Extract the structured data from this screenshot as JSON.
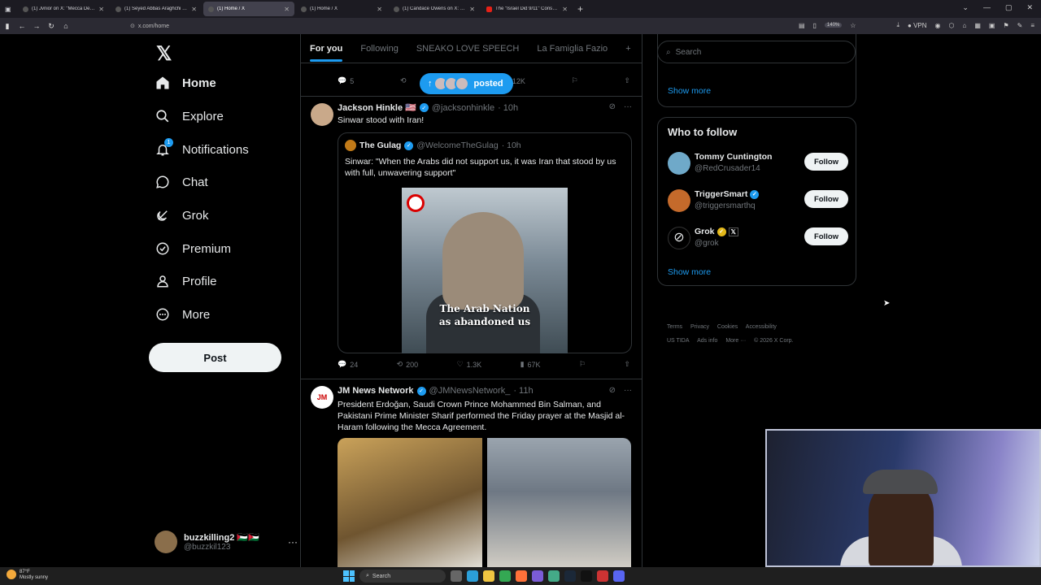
{
  "browser": {
    "tabs": [
      {
        "title": "(1) Jvnior on X: \"Mecca Defens...",
        "active": false
      },
      {
        "title": "(1) Seyed Abbas Araghchi on X...",
        "active": false
      },
      {
        "title": "(1) Home / X",
        "active": true
      },
      {
        "title": "(1) Home / X",
        "active": false
      },
      {
        "title": "(1) Candace Owens on X: \"You...",
        "active": false
      },
      {
        "title": "The \"Israel Did 9/11\" Conspira...",
        "active": false
      }
    ],
    "new_tab": "+",
    "url": "x.com/home",
    "zoom": "140%",
    "vpn": "VPN"
  },
  "nav": {
    "logo": "𝕏",
    "items": [
      {
        "label": "Home",
        "icon": "home-icon"
      },
      {
        "label": "Explore",
        "icon": "search-icon"
      },
      {
        "label": "Notifications",
        "icon": "bell-icon",
        "badge": "1"
      },
      {
        "label": "Chat",
        "icon": "chat-icon"
      },
      {
        "label": "Grok",
        "icon": "grok-icon"
      },
      {
        "label": "Premium",
        "icon": "premium-icon"
      },
      {
        "label": "Profile",
        "icon": "person-icon"
      },
      {
        "label": "More",
        "icon": "more-circle-icon"
      }
    ],
    "post_label": "Post",
    "account": {
      "name": "buzzkilling2 🇵🇸🇯🇴",
      "handle": "@buzzkil123"
    }
  },
  "feed": {
    "tabs": [
      "For you",
      "Following",
      "SNEAKO LOVE SPEECH",
      "La Famiglia Fazio"
    ],
    "add_tab": "+",
    "posted_pill": "posted",
    "prev_actions": {
      "replies": "5",
      "reposts": "",
      "likes": "",
      "views": "12K"
    },
    "tweets": [
      {
        "name": "Jackson Hinkle 🇺🇸",
        "handle": "@jacksonhinkle",
        "time": "· 10h",
        "text": "Sinwar stood with Iran!",
        "quote": {
          "name": "The Gulag",
          "handle": "@WelcomeTheGulag",
          "time": "· 10h",
          "text": "Sinwar: \"When the Arabs did not support us, it was Iran that stood by us with full, unwavering support\"",
          "caption_line1": "The Arab Nation",
          "caption_line2": "as abandoned us"
        },
        "actions": {
          "replies": "24",
          "reposts": "200",
          "likes": "1.3K",
          "views": "67K"
        }
      },
      {
        "name": "JM News Network",
        "handle": "@JMNewsNetwork_",
        "time": "· 11h",
        "text": "President Erdoğan, Saudi Crown Prince Mohammed Bin Salman, and Pakistani Prime Minister Sharif performed the Friday prayer at the Masjid al-Haram following the Mecca Agreement."
      }
    ]
  },
  "sidebar": {
    "search_placeholder": "Search",
    "trend_show_more": "Show more",
    "who_to_follow": "Who to follow",
    "follow_suggestions": [
      {
        "name": "Tommy Cuntington",
        "handle": "@RedCrusader14",
        "button": "Follow"
      },
      {
        "name": "TriggerSmart",
        "handle": "@triggersmarthq",
        "button": "Follow"
      },
      {
        "name": "Grok",
        "handle": "@grok",
        "button": "Follow"
      }
    ],
    "wtf_show_more": "Show more",
    "footer": [
      "Terms",
      "Privacy",
      "Cookies",
      "Accessibility",
      "US TIDA",
      "Ads info",
      "More ···",
      "© 2026 X Corp."
    ]
  },
  "taskbar": {
    "weather_temp": "87°F",
    "weather_desc": "Mostly sunny",
    "search": "Search"
  },
  "colors": {
    "accent": "#1d9bf0",
    "verified_gold": "#e2b719"
  }
}
